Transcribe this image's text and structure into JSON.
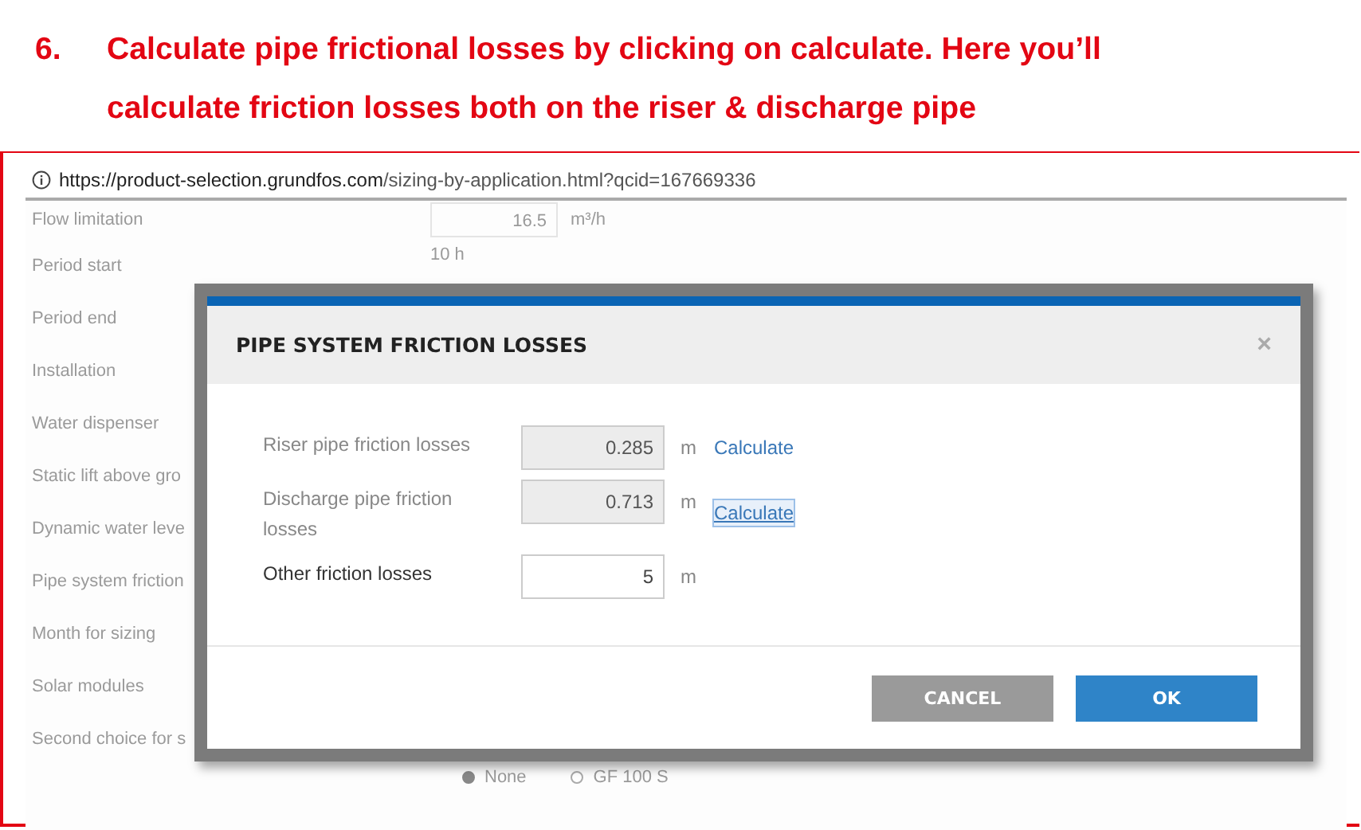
{
  "heading": {
    "number": "6.",
    "lines": [
      "Calculate pipe frictional losses by clicking on calculate. Here you’ll",
      "calculate friction losses both on the riser & discharge pipe"
    ]
  },
  "browser": {
    "url_host": "https://product-selection.grundfos.com",
    "url_path": "/sizing-by-application.html?qcid=167669336"
  },
  "background_form": {
    "rows": [
      {
        "label": "Flow limitation",
        "kind": "field",
        "value": "16.5",
        "unit": "m³/h"
      },
      {
        "label": "Period start",
        "kind": "text",
        "value": "10 h"
      },
      {
        "label": "Period end",
        "kind": "plain"
      },
      {
        "label": "Installation",
        "kind": "plain"
      },
      {
        "label": "Water dispenser",
        "kind": "plain"
      },
      {
        "label": "Static lift above gro",
        "kind": "plain"
      },
      {
        "label": "Dynamic water leve",
        "kind": "plain"
      },
      {
        "label": "Pipe system friction",
        "kind": "plain"
      },
      {
        "label": "Month for sizing",
        "kind": "plain"
      },
      {
        "label": "Solar modules",
        "kind": "plain"
      },
      {
        "label": "Second choice for s",
        "kind": "radios",
        "options": [
          {
            "label": "None",
            "selected": true
          },
          {
            "label": "GF 100 S",
            "selected": false
          }
        ]
      }
    ]
  },
  "dialog": {
    "title": "PIPE SYSTEM FRICTION LOSSES",
    "close": "×",
    "rows": [
      {
        "label": "Riser pipe friction losses",
        "value": "0.285",
        "unit": "m",
        "readonly": true,
        "action": "Calculate",
        "focused": false
      },
      {
        "label": "Discharge pipe friction losses",
        "value": "0.713",
        "unit": "m",
        "readonly": true,
        "action": "Calculate",
        "focused": true
      },
      {
        "label": "Other friction losses",
        "value": "5",
        "unit": "m",
        "readonly": false
      }
    ],
    "buttons": [
      {
        "label": "CANCEL",
        "kind": "secondary"
      },
      {
        "label": "OK",
        "kind": "primary"
      }
    ]
  }
}
